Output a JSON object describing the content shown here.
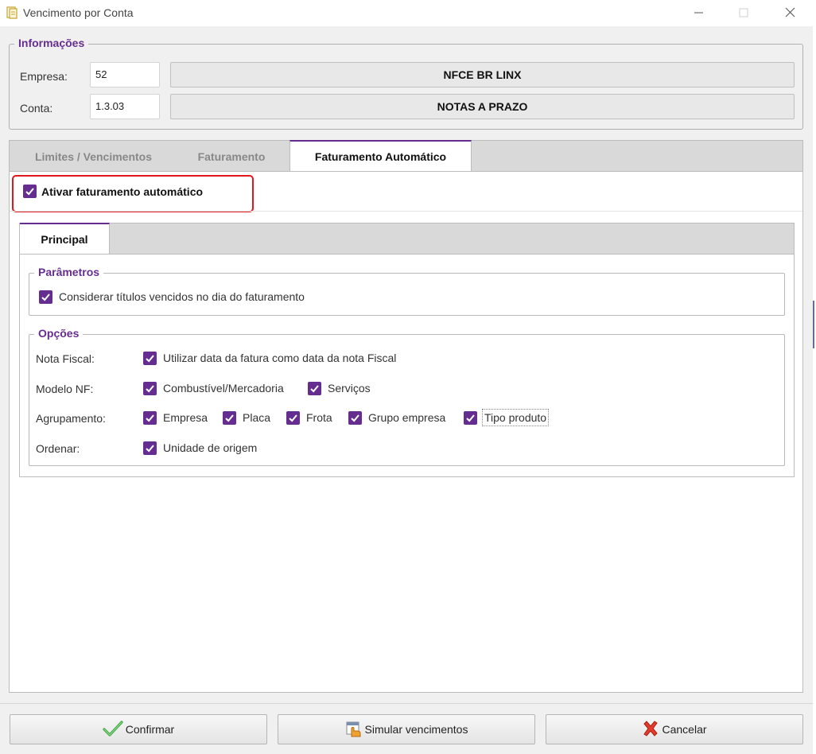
{
  "window": {
    "title": "Vencimento por Conta"
  },
  "info": {
    "legend": "Informações",
    "empresa_label": "Empresa:",
    "empresa_code": "52",
    "empresa_name": "NFCE BR LINX",
    "conta_label": "Conta:",
    "conta_code": "1.3.03",
    "conta_name": "NOTAS A PRAZO"
  },
  "tabs": [
    {
      "label": "Limites / Vencimentos",
      "active": false
    },
    {
      "label": "Faturamento",
      "active": false
    },
    {
      "label": "Faturamento Automático",
      "active": true
    }
  ],
  "auto": {
    "enable_label": "Ativar faturamento automático",
    "enable_checked": true
  },
  "subtabs": [
    {
      "label": "Principal",
      "active": true
    }
  ],
  "parametros": {
    "legend": "Parâmetros",
    "considerar_label": "Considerar títulos vencidos no dia do faturamento",
    "considerar_checked": true
  },
  "opcoes": {
    "legend": "Opções",
    "nota_fiscal_label": "Nota Fiscal:",
    "nota_fiscal_option": "Utilizar data da fatura como data da nota Fiscal",
    "modelo_label": "Modelo NF:",
    "modelo_options": [
      "Combustível/Mercadoria",
      "Serviços"
    ],
    "agrupamento_label": "Agrupamento:",
    "agrupamento_options": [
      "Empresa",
      "Placa",
      "Frota",
      "Grupo empresa",
      "Tipo produto"
    ],
    "ordenar_label": "Ordenar:",
    "ordenar_option": "Unidade de origem"
  },
  "buttons": {
    "confirm": "Confirmar",
    "simulate": "Simular vencimentos",
    "cancel": "Cancelar"
  },
  "colors": {
    "accent": "#662d91",
    "highlight": "#e2171b"
  },
  "icons": {
    "app": "document-icon",
    "confirm": "green-check-icon",
    "simulate": "calendar-hand-icon",
    "cancel": "red-x-icon"
  }
}
